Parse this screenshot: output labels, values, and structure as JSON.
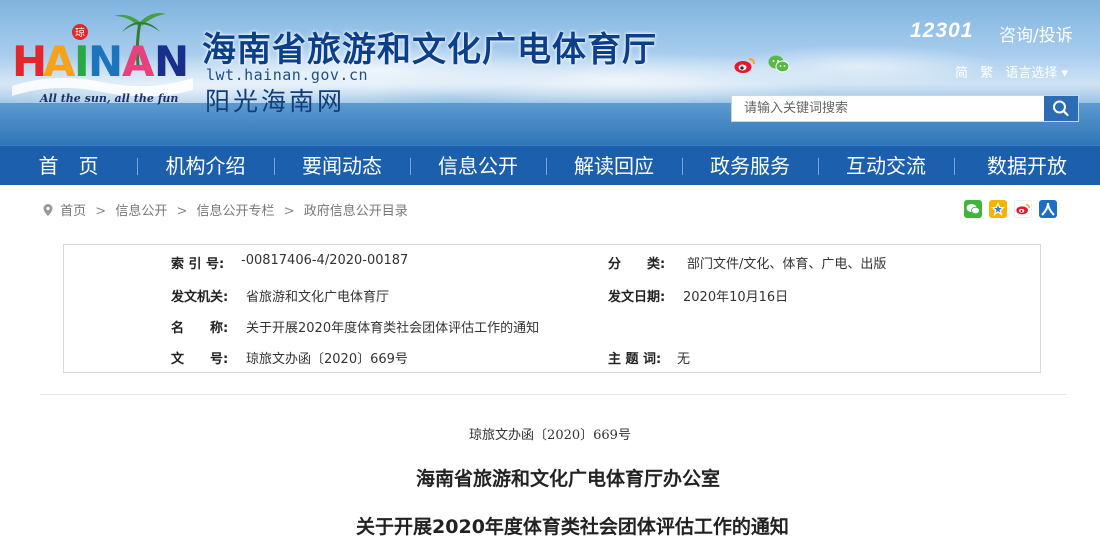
{
  "header": {
    "logo_text": "HAINAN",
    "logo_slogan": "All the sun, all the fun",
    "site_title": "海南省旅游和文化广电体育厅",
    "site_domain": "lwt.hainan.gov.cn",
    "site_subtitle": "阳光海南网",
    "hotline": "12301",
    "consult_label": "咨询/投诉",
    "lang_simplified": "简",
    "lang_traditional": "繁",
    "lang_select": "语言选择 ▾",
    "search_placeholder": "请输入关键词搜索"
  },
  "nav": {
    "items": [
      {
        "label": "首　页"
      },
      {
        "label": "机构介绍"
      },
      {
        "label": "要闻动态"
      },
      {
        "label": "信息公开"
      },
      {
        "label": "解读回应"
      },
      {
        "label": "政务服务"
      },
      {
        "label": "互动交流"
      },
      {
        "label": "数据开放"
      }
    ]
  },
  "breadcrumb": {
    "items": [
      "首页",
      "信息公开",
      "信息公开专栏",
      "政府信息公开目录"
    ],
    "separator": ">"
  },
  "share_icons": [
    "wechat-share-icon",
    "qzone-share-icon",
    "weibo-share-icon",
    "renren-share-icon"
  ],
  "meta": {
    "index_key": "索 引 号:",
    "index_val": "-00817406-4/2020-00187",
    "category_key": "分　　类:",
    "category_val": "部门文件/文化、体育、广电、出版",
    "issuer_key": "发文机关:",
    "issuer_val": "省旅游和文化广电体育厅",
    "date_key": "发文日期:",
    "date_val": "2020年10月16日",
    "name_key": "名　　称:",
    "name_val": "关于开展2020年度体育类社会团体评估工作的通知",
    "docno_key": "文　　号:",
    "docno_val": "琼旅文办函〔2020〕669号",
    "subject_key": "主 题 词:",
    "subject_val": "无"
  },
  "document": {
    "number": "琼旅文办函〔2020〕669号",
    "org": "海南省旅游和文化广电体育厅办公室",
    "title": "关于开展2020年度体育类社会团体评估工作的通知"
  },
  "colors": {
    "nav_bg": "#1b5fad",
    "title_blue": "#0c3f8a"
  }
}
